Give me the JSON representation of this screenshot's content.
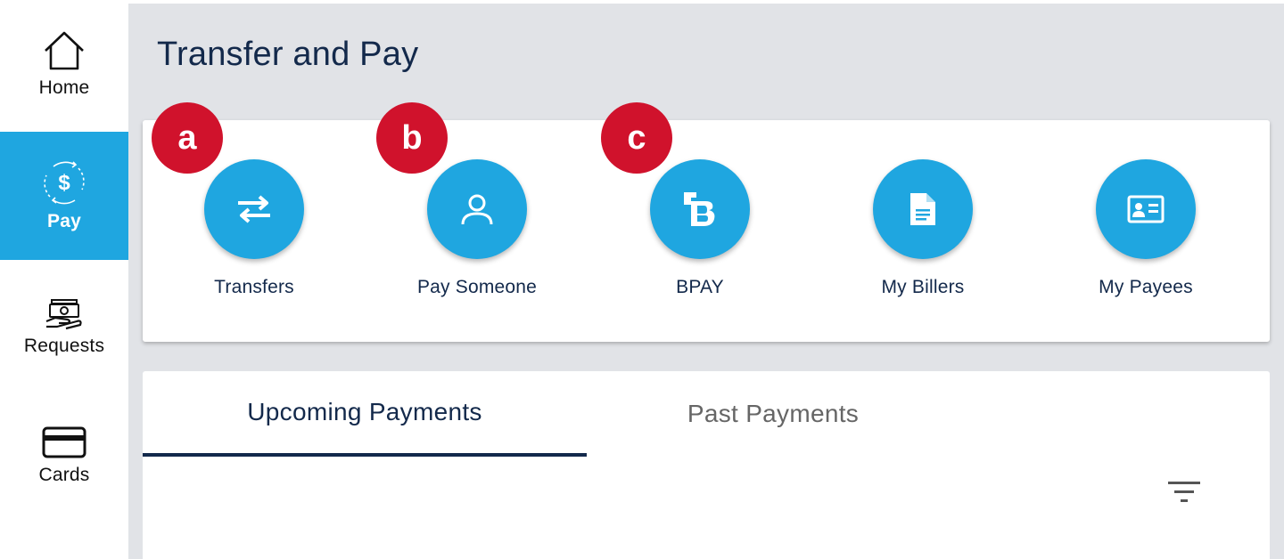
{
  "sidebar": {
    "items": [
      {
        "label": "Home",
        "icon": "home-icon"
      },
      {
        "label": "Pay",
        "icon": "pay-icon",
        "active": true
      },
      {
        "label": "Requests",
        "icon": "requests-icon"
      },
      {
        "label": "Cards",
        "icon": "card-icon"
      }
    ]
  },
  "page": {
    "title": "Transfer and Pay"
  },
  "actions": [
    {
      "label": "Transfers",
      "icon": "transfer-arrows-icon",
      "badge": "a"
    },
    {
      "label": "Pay Someone",
      "icon": "person-icon",
      "badge": "b"
    },
    {
      "label": "BPAY",
      "icon": "bpay-icon",
      "badge": "c"
    },
    {
      "label": "My Billers",
      "icon": "document-icon"
    },
    {
      "label": "My Payees",
      "icon": "contact-card-icon"
    }
  ],
  "payments": {
    "tabs": [
      {
        "label": "Upcoming Payments",
        "active": true
      },
      {
        "label": "Past Payments"
      }
    ],
    "filter_icon": "filter-icon"
  },
  "colors": {
    "accent": "#1fa6e0",
    "badge": "#d0122c",
    "navy": "#13294b",
    "background": "#e1e3e7"
  }
}
